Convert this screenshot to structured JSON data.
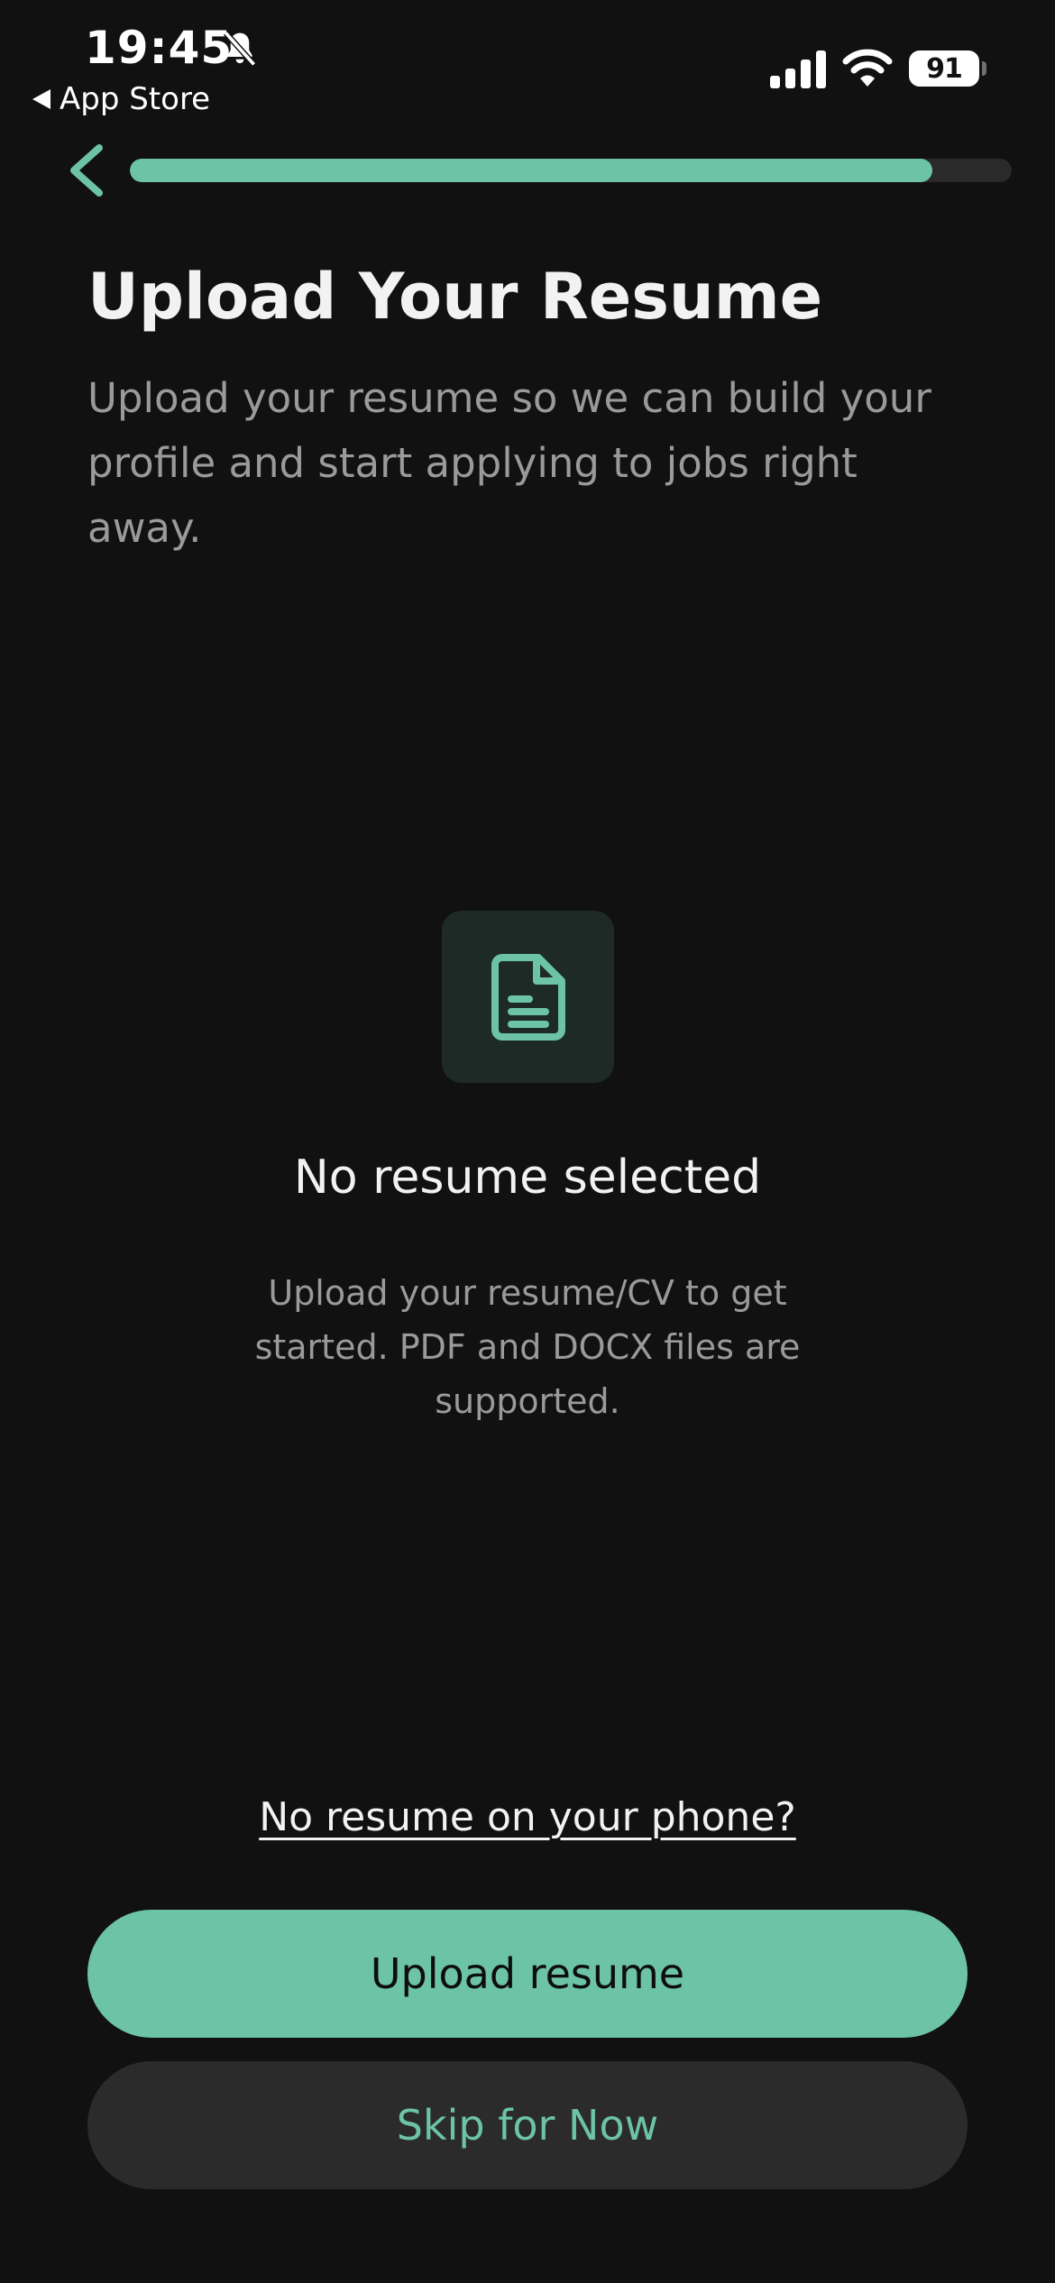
{
  "status_bar": {
    "time": "19:45",
    "back_app_label": "App Store",
    "battery_level": "91"
  },
  "progress": {
    "value_percent": 91
  },
  "header": {
    "title": "Upload Your Resume",
    "subtitle": "Upload your resume so we can build your profile and start applying to jobs right away."
  },
  "empty_state": {
    "icon": "document-icon",
    "title": "No resume selected",
    "description": "Upload your resume/CV to get started. PDF and DOCX files are supported."
  },
  "actions": {
    "no_resume_link": "No resume on your phone?",
    "upload_label": "Upload resume",
    "skip_label": "Skip for Now"
  },
  "colors": {
    "accent": "#6cc3a6",
    "background": "#111111",
    "secondary_button": "#2b2b2b"
  }
}
